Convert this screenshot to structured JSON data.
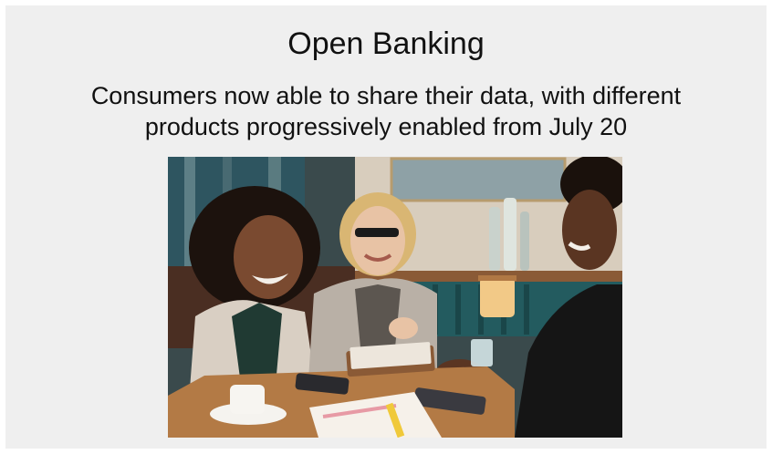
{
  "slide": {
    "title": "Open Banking",
    "subtitle_line1": "Consumers now able to share their data, with different",
    "subtitle_line2": "products progressively enabled from July 20"
  },
  "colors": {
    "slide_background": "#efefef",
    "text": "#111111"
  },
  "photo": {
    "description_icon": "photo-of-three-women-laughing-at-cafe-table"
  }
}
